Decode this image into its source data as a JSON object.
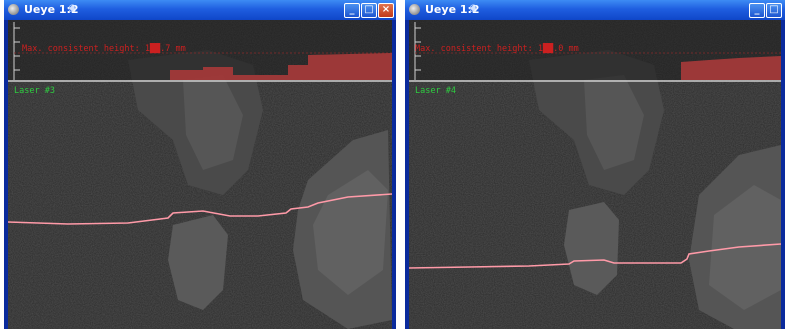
{
  "windows": [
    {
      "title": "Ueye 1:2",
      "laser_label": "Laser #3",
      "height_text": "Max. consistent height: 1██.7 mm"
    },
    {
      "title": "Ueye 1:2",
      "laser_label": "Laser #4",
      "height_text": "Max. consistent height: 1██.0 mm"
    }
  ],
  "colors": {
    "titlebar": "#1f5ee0",
    "laser_text": "#2ecc40",
    "height_text": "#cc2020",
    "laser_line": "#ff9aa8",
    "profile_fill": "#a83a3a"
  },
  "icons": {
    "app": "camera-app-icon",
    "pin": "pin-icon",
    "minimize": "minimize-icon",
    "maximize": "maximize-icon",
    "close": "close-icon"
  }
}
